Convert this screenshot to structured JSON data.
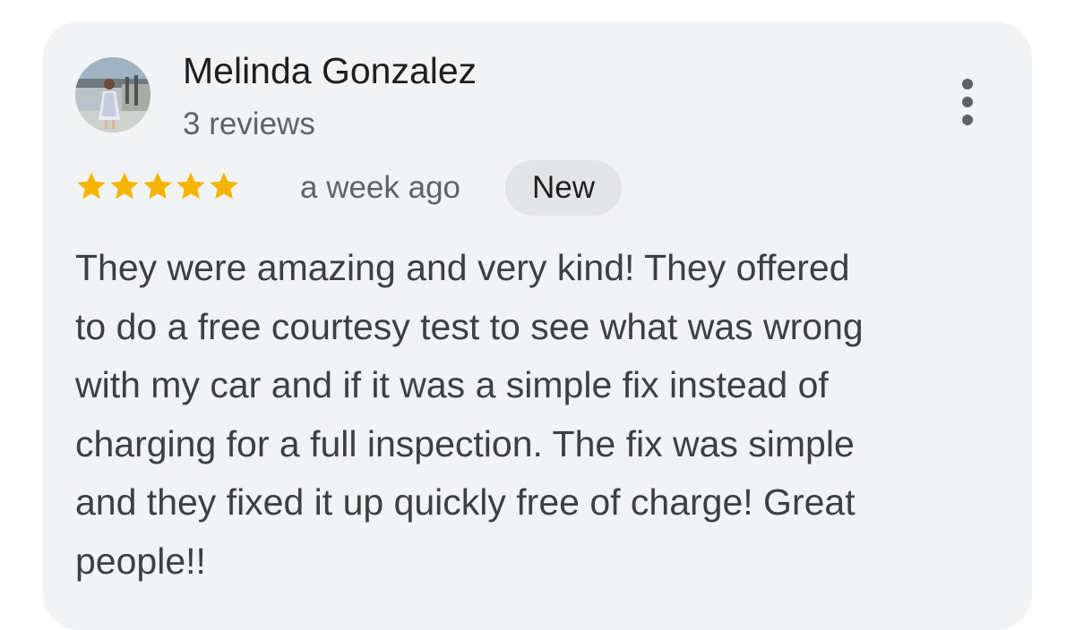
{
  "review": {
    "author": {
      "name": "Melinda Gonzalez",
      "review_count_label": "3 reviews"
    },
    "rating": {
      "stars": 5,
      "max": 5,
      "star_color": "#f4b400"
    },
    "time_ago": "a week ago",
    "badge": "New",
    "text": "They were amazing and very kind! They offered\nto do a free courtesy test to see what was wrong\nwith my car and if it was a simple fix instead of\ncharging for a full inspection. The fix was simple\nand they fixed it up quickly free of charge! Great\npeople!!"
  },
  "icons": {
    "more": "more-vert-icon",
    "star": "star-icon"
  },
  "colors": {
    "card_background": "#f2f3f5",
    "badge_background": "#e2e4e7",
    "secondary_text": "#5f6368"
  }
}
